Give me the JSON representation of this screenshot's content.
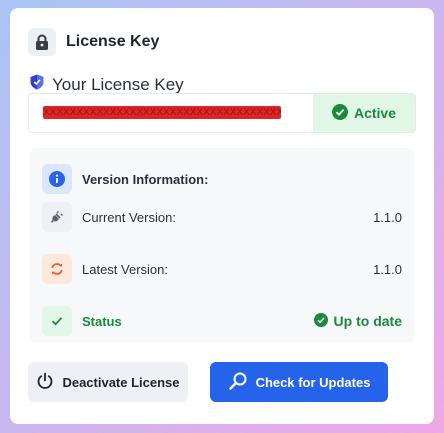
{
  "header": {
    "title": "License Key",
    "icon": "lock-icon"
  },
  "license": {
    "label": "Your License Key",
    "key_value": "XXXXXXXXXXXXXXXXXXXXXXXXXXXXXXXXXXXXXXXXXXXX",
    "status_label": "Active",
    "colors": {
      "redaction": "#e02424",
      "active_bg": "#e1f7e6",
      "active_text": "#1a8a3c"
    }
  },
  "version_info": {
    "title": "Version Information:",
    "current_label": "Current Version:",
    "current_value": "1.1.0",
    "latest_label": "Latest Version:",
    "latest_value": "1.1.0",
    "status_label": "Status",
    "status_value": "Up to date"
  },
  "actions": {
    "deactivate_label": "Deactivate License",
    "check_label": "Check for Updates",
    "colors": {
      "primary": "#2563eb"
    }
  }
}
